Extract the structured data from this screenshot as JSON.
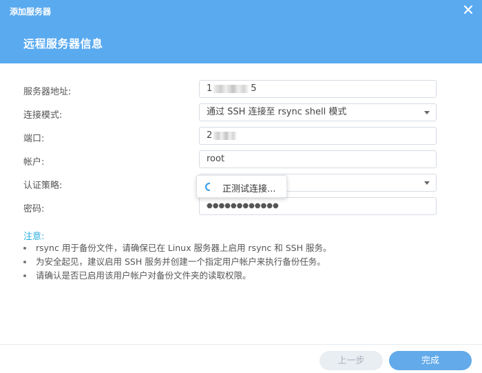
{
  "dialog": {
    "title": "添加服务器",
    "subtitle": "远程服务器信息",
    "close_icon": "close-icon"
  },
  "form": {
    "server_address": {
      "label": "服务器地址:",
      "value_prefix": "1",
      "value_suffix": "5"
    },
    "connection_mode": {
      "label": "连接模式:",
      "value": "通过 SSH 连接至 rsync shell 模式"
    },
    "port": {
      "label": "端口:",
      "value_prefix": "2"
    },
    "account": {
      "label": "帐户:",
      "value": "root"
    },
    "auth_policy": {
      "label": "认证策略:",
      "value": ""
    },
    "password": {
      "label": "密码:",
      "value": "●●●●●●●●●●●●"
    }
  },
  "popup": {
    "text": "正测试连接..."
  },
  "notes": {
    "title": "注意:",
    "items": [
      "rsync 用于备份文件，请确保已在 Linux 服务器上启用 rsync 和 SSH 服务。",
      "为安全起见，建议启用 SSH 服务并创建一个指定用户帐户来执行备份任务。",
      "请确认是否已启用该用户帐户对备份文件夹的读取权限。"
    ]
  },
  "footer": {
    "prev_label": "上一步",
    "done_label": "完成"
  },
  "colors": {
    "header": "#5aaaf0",
    "accent": "#27aede",
    "primary_button": "#62aaea"
  }
}
